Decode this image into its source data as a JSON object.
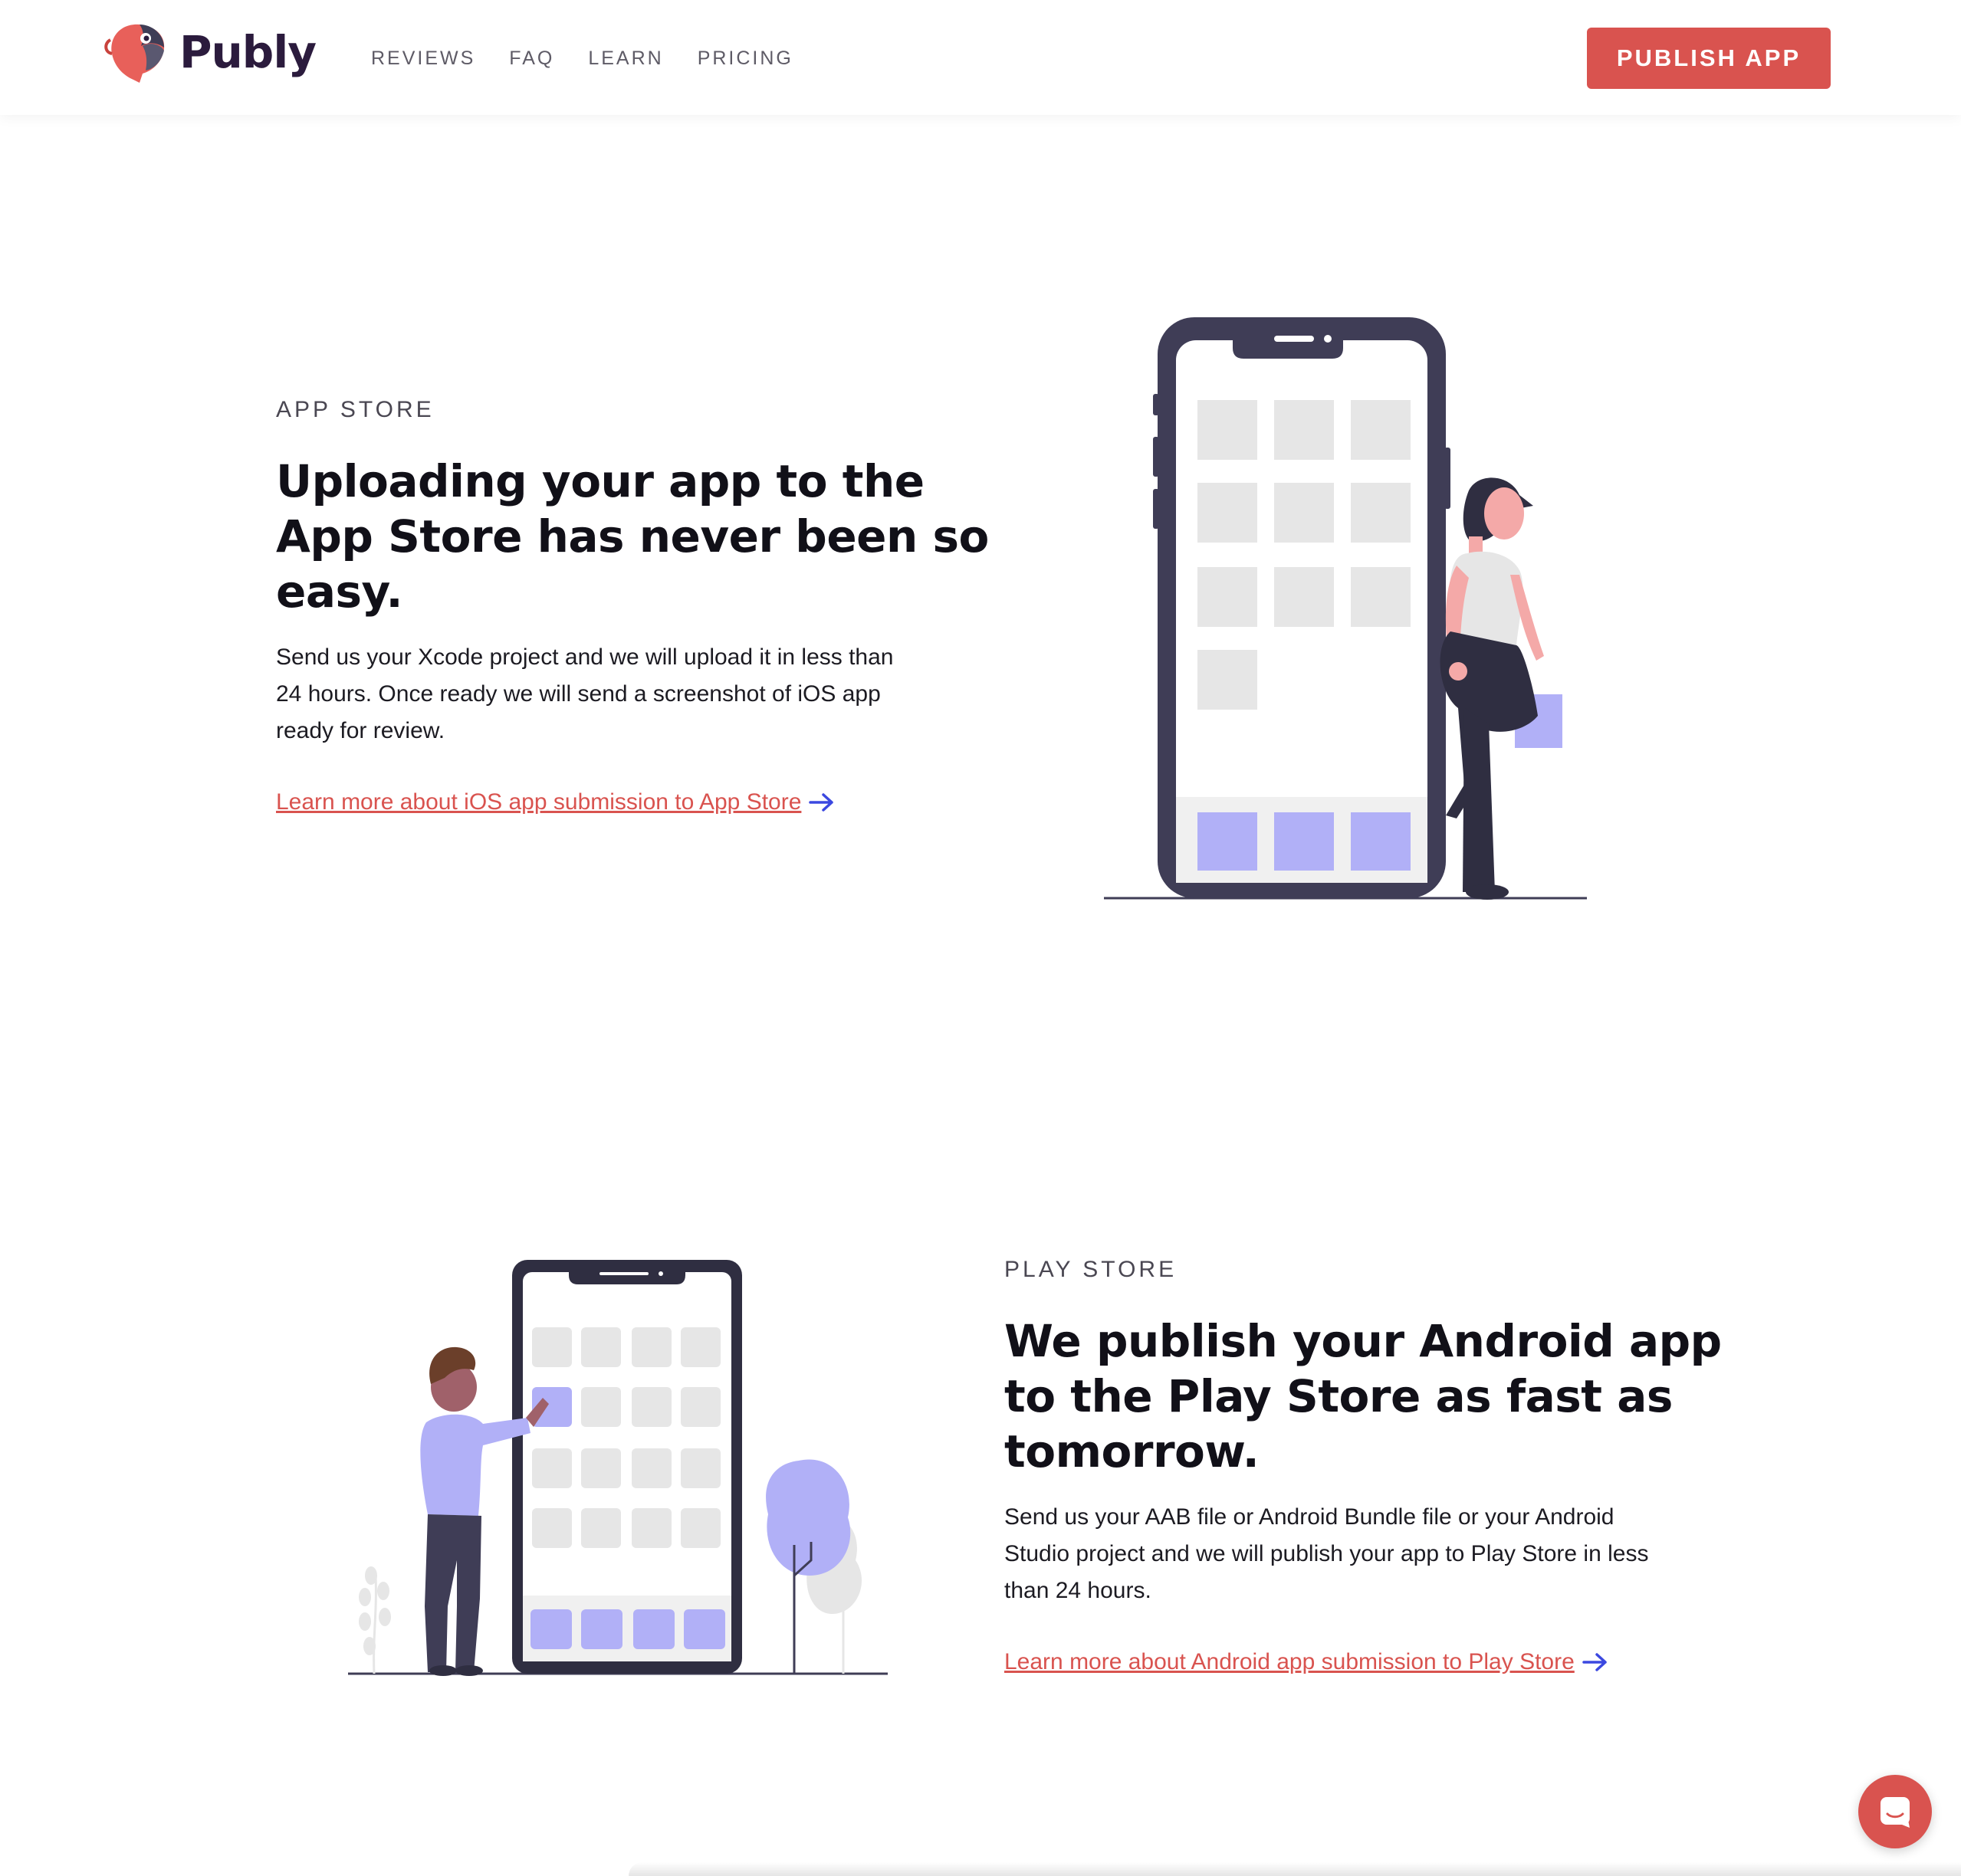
{
  "header": {
    "brand": "Publy",
    "nav": [
      "REVIEWS",
      "FAQ",
      "LEARN",
      "PRICING"
    ],
    "cta_label": "PUBLISH APP"
  },
  "app_store": {
    "eyebrow": "APP STORE",
    "headline": [
      "Uploading your app to the",
      "App Store has never been so",
      "easy."
    ],
    "body": [
      "Send us your Xcode project and we will upload it in less than",
      "24 hours. Once ready we will send a screenshot of iOS app",
      "ready for review."
    ],
    "link": "Learn more about iOS app submission to App Store"
  },
  "play_store": {
    "eyebrow": "PLAY STORE",
    "headline": [
      "We publish your Android app",
      "to the Play Store as fast as",
      "tomorrow."
    ],
    "body": [
      "Send us your AAB file or Android Bundle file or your Android",
      "Studio project and we will publish your app to Play Store in less",
      "than 24 hours."
    ],
    "link": "Learn more about Android app submission to Play Store"
  },
  "colors": {
    "accent": "#d9534f",
    "ink": "#3f3d56",
    "violet": "#b1b0f7",
    "arrow": "#3b48e0",
    "tile": "#e6e6e6"
  },
  "icons": [
    "parrot-logo-icon",
    "arrow-right-icon",
    "chat-icon"
  ]
}
